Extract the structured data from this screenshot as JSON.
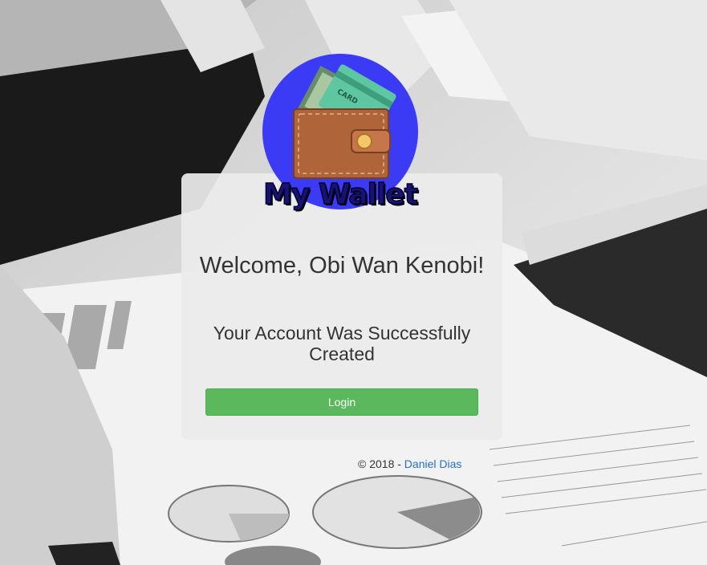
{
  "brand": {
    "logo_text": "My Wallet",
    "card_text": "CARD",
    "logo_bg_color": "#3b3bf5",
    "wallet_color": "#b0643a"
  },
  "main": {
    "welcome": "Welcome, Obi Wan Kenobi!",
    "message": "Your Account Was Successfully Created",
    "login_label": "Login",
    "button_color": "#5cb85c"
  },
  "footer": {
    "copyright": "© 2018 - ",
    "author_link": "Daniel Dias",
    "link_color": "#2a6fc0"
  }
}
